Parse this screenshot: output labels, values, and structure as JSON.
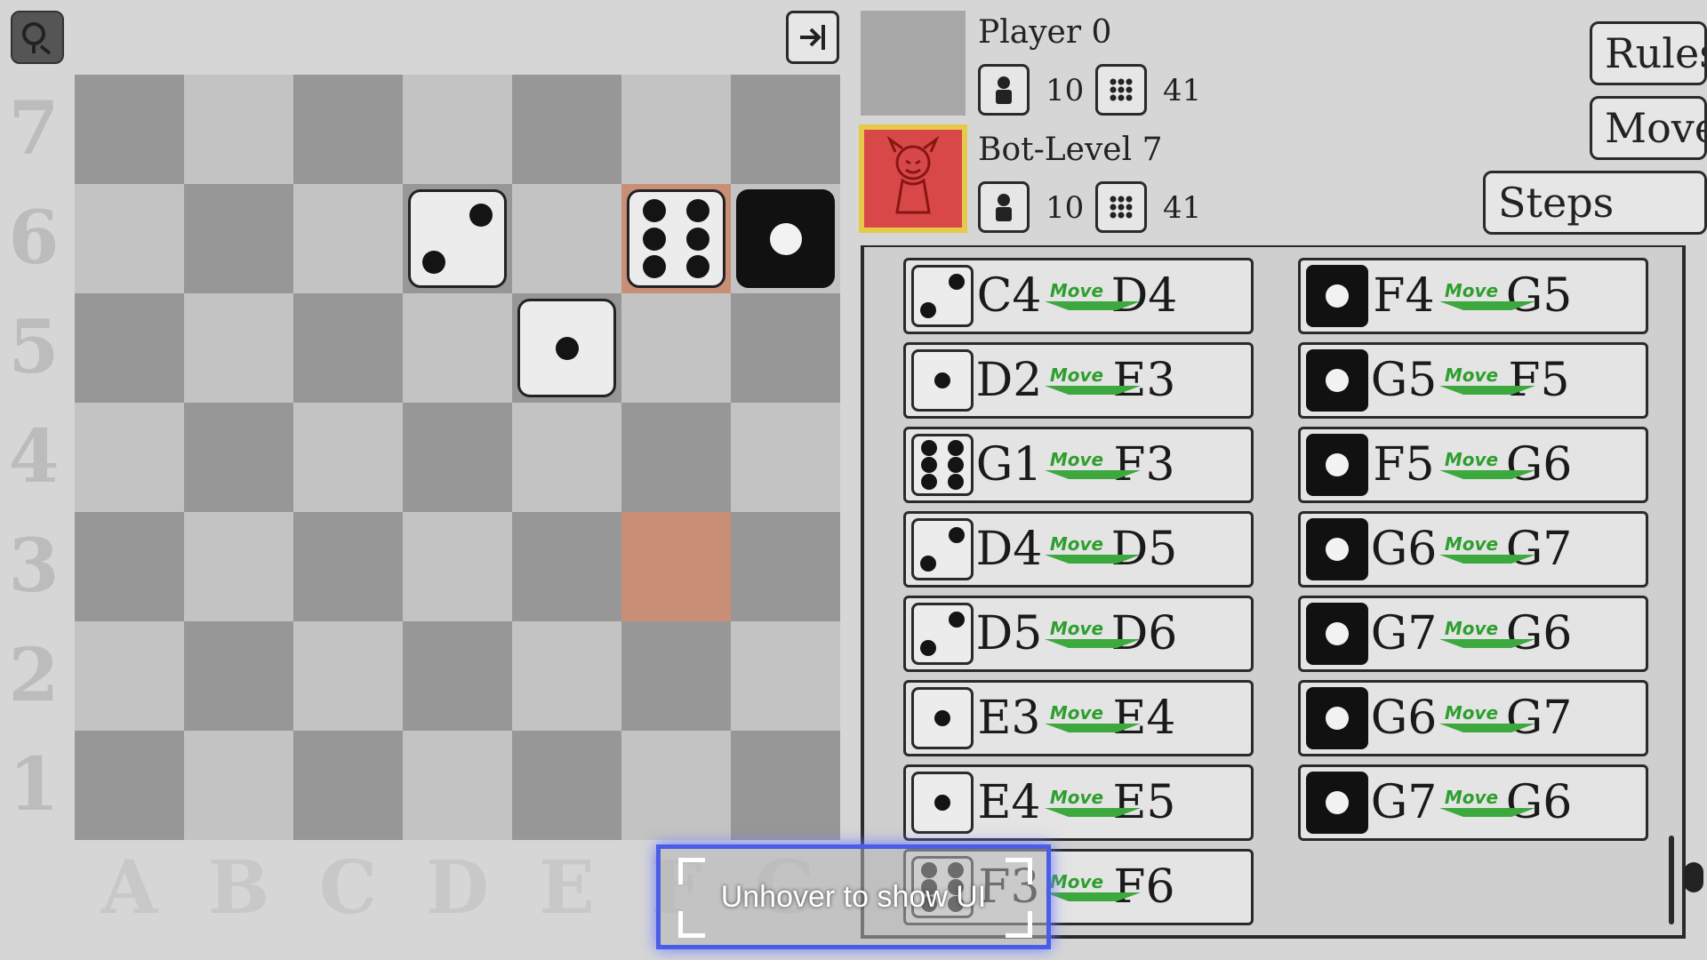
{
  "board": {
    "ranks": [
      "7",
      "6",
      "5",
      "4",
      "3",
      "2",
      "1"
    ],
    "files": [
      "A",
      "B",
      "C",
      "D",
      "E",
      "F",
      "G"
    ],
    "pieces": [
      {
        "square": "D6",
        "color": "white",
        "pips": 2
      },
      {
        "square": "F6",
        "color": "white",
        "pips": 6,
        "highlight": true
      },
      {
        "square": "G6",
        "color": "black",
        "pips": 1
      },
      {
        "square": "E5",
        "color": "white",
        "pips": 1
      }
    ],
    "highlighted_squares": [
      "F6",
      "F3"
    ]
  },
  "players": [
    {
      "name": "Player 0",
      "pieces": "10",
      "score": "41"
    },
    {
      "name": "Bot-Level 7",
      "pieces": "10",
      "score": "41"
    }
  ],
  "side_buttons": {
    "rules": "Rules",
    "moves": "Moves",
    "steps": "Steps"
  },
  "move_word": "Move",
  "moves_left": [
    {
      "from": "C4",
      "to": "D4",
      "die": "white",
      "pips": 2
    },
    {
      "from": "D2",
      "to": "E3",
      "die": "white",
      "pips": 1
    },
    {
      "from": "G1",
      "to": "F3",
      "die": "white",
      "pips": 6
    },
    {
      "from": "D4",
      "to": "D5",
      "die": "white",
      "pips": 2
    },
    {
      "from": "D5",
      "to": "D6",
      "die": "white",
      "pips": 2
    },
    {
      "from": "E3",
      "to": "E4",
      "die": "white",
      "pips": 1
    },
    {
      "from": "E4",
      "to": "E5",
      "die": "white",
      "pips": 1
    },
    {
      "from": "F3",
      "to": "F6",
      "die": "white",
      "pips": 6
    }
  ],
  "moves_right": [
    {
      "from": "F4",
      "to": "G5",
      "die": "black",
      "pips": 1
    },
    {
      "from": "G5",
      "to": "F5",
      "die": "black",
      "pips": 1
    },
    {
      "from": "F5",
      "to": "G6",
      "die": "black",
      "pips": 1
    },
    {
      "from": "G6",
      "to": "G7",
      "die": "black",
      "pips": 1
    },
    {
      "from": "G7",
      "to": "G6",
      "die": "black",
      "pips": 1
    },
    {
      "from": "G6",
      "to": "G7",
      "die": "black",
      "pips": 1
    },
    {
      "from": "G7",
      "to": "G6",
      "die": "black",
      "pips": 1
    }
  ],
  "hover_hint": "Unhover to show UI",
  "colors": {
    "highlight": "#c98e76",
    "bot_avatar": "#d84848",
    "active_frame": "#e6c84a",
    "move_green": "#2e9f2e",
    "hover_border": "#4a5de8"
  }
}
